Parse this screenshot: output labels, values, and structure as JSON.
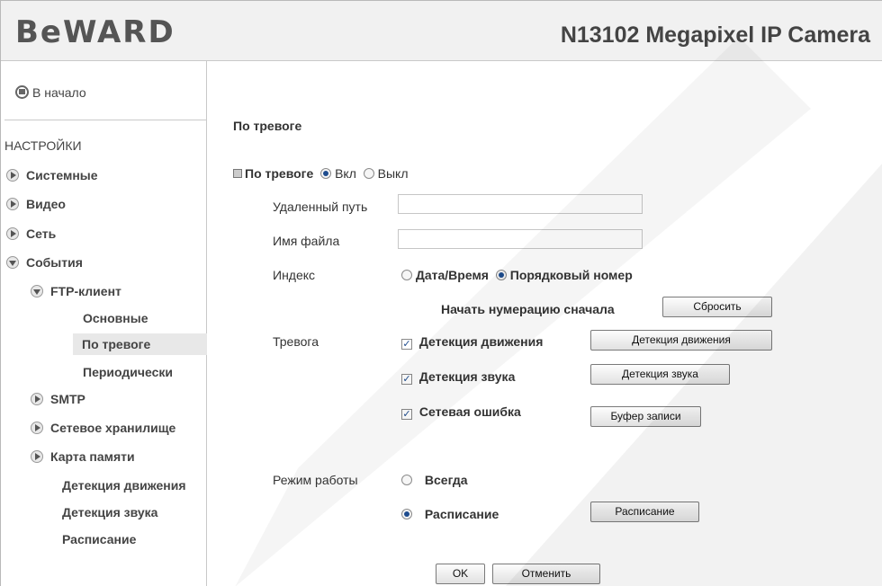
{
  "header": {
    "logo": "BeWARD",
    "camera_title": "N13102 Megapixel IP Camera"
  },
  "sidebar": {
    "home": "В начало",
    "settings_title": "НАСТРОЙКИ",
    "items": [
      {
        "label": "Системные"
      },
      {
        "label": "Видео"
      },
      {
        "label": "Сеть"
      },
      {
        "label": "События"
      },
      {
        "label": "FTP-клиент"
      },
      {
        "label": "Основные"
      },
      {
        "label": "По тревоге"
      },
      {
        "label": "Периодически"
      },
      {
        "label": "SMTP"
      },
      {
        "label": "Сетевое хранилище"
      },
      {
        "label": "Карта памяти"
      },
      {
        "label": "Детекция движения"
      },
      {
        "label": "Детекция звука"
      },
      {
        "label": "Расписание"
      }
    ]
  },
  "form": {
    "section_title": "По тревоге",
    "toggle_label": "По тревоге",
    "toggle_on": "Вкл",
    "toggle_off": "Выкл",
    "remote_path_label": "Удаленный путь",
    "remote_path_value": "",
    "file_name_label": "Имя файла",
    "file_name_value": "",
    "index_label": "Индекс",
    "index_datetime": "Дата/Время",
    "index_sequence": "Порядковый номер",
    "restart_numbering": "Начать нумерацию сначала",
    "reset_button": "Сбросить",
    "alarm_label": "Тревога",
    "alarm_motion": "Детекция движения",
    "alarm_motion_button": "Детекция движения",
    "alarm_sound": "Детекция звука",
    "alarm_sound_button": "Детекция звука",
    "alarm_network": "Сетевая ошибка",
    "buffer_button": "Буфер записи",
    "mode_label": "Режим работы",
    "mode_always": "Всегда",
    "mode_schedule": "Расписание",
    "schedule_button": "Расписание",
    "ok_button": "OK",
    "cancel_button": "Отменить"
  },
  "colors": {
    "header_bg": "#f1f1f1",
    "accent": "#1e4c8e",
    "selected_bg": "#e8e8e8"
  },
  "icons": {
    "home": "home-icon",
    "arrow": "chevron-right-icon",
    "arrow_open": "chevron-down-icon"
  }
}
